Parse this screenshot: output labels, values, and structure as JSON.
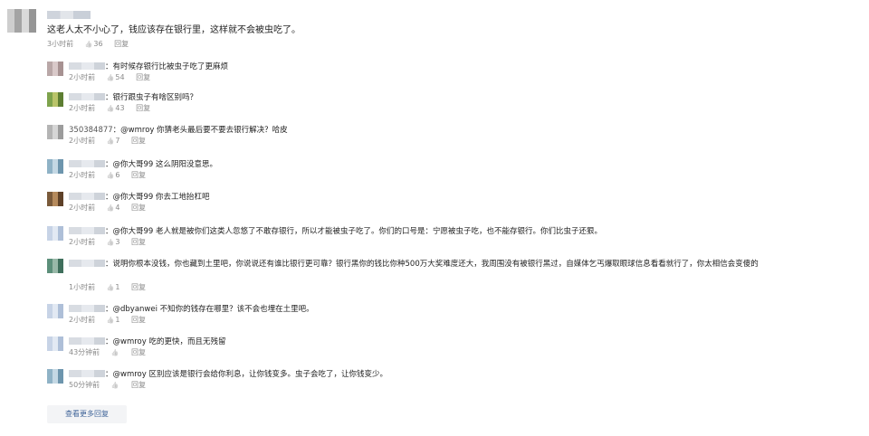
{
  "top_comment": {
    "text": "这老人太不小心了，钱应该存在银行里，这样就不会被虫吃了。",
    "time": "3小时前",
    "likes": "36",
    "reply_label": "回复"
  },
  "replies": [
    {
      "username": "",
      "text": "：有时候存银行比被虫子吃了更麻烦",
      "time": "2小时前",
      "likes": "54",
      "reply_label": "回复"
    },
    {
      "username": "",
      "text": "：银行跟虫子有啥区别吗？",
      "time": "2小时前",
      "likes": "43",
      "reply_label": "回复"
    },
    {
      "username": "350384877",
      "text": "：@wmroy 你猜老头最后要不要去银行解决？哈皮",
      "time": "2小时前",
      "likes": "7",
      "reply_label": "回复"
    },
    {
      "username": "",
      "text": "：@你大哥99 这么阴阳没意思。",
      "time": "2小时前",
      "likes": "6",
      "reply_label": "回复"
    },
    {
      "username": "",
      "text": "：@你大哥99 你去工地抬杠吧",
      "time": "2小时前",
      "likes": "4",
      "reply_label": "回复"
    },
    {
      "username": "",
      "text": "：@你大哥99 老人就是被你们这类人忽悠了不敢存银行，所以才能被虫子吃了。你们的口号是：宁愿被虫子吃，也不能存银行。你们比虫子还狠。",
      "time": "2小时前",
      "likes": "3",
      "reply_label": "回复"
    },
    {
      "username": "",
      "text": "：说明你根本没钱，你也藏到土里吧，你说说还有谁比银行更可靠？银行黑你的钱比你种500万大奖难度还大，我周围没有被银行黑过，自媒体乞丐爆取眼球信息看看就行了，你太相信会变傻的",
      "time": "1小时前",
      "likes": "1",
      "reply_label": "回复"
    },
    {
      "username": "",
      "text": "：@dbyanwei 不知你的钱存在哪里？该不会也埋在土里吧。",
      "time": "2小时前",
      "likes": "1",
      "reply_label": "回复"
    },
    {
      "username": "",
      "text": "：@wmroy 吃的更快，而且无残留",
      "time": "43分钟前",
      "likes": "",
      "reply_label": "回复"
    },
    {
      "username": "",
      "text": "：@wmroy 区别应该是银行会给你利息，让你钱变多。虫子会吃了，让你钱变少。",
      "time": "50分钟前",
      "likes": "",
      "reply_label": "回复"
    }
  ],
  "load_more_label": "查看更多回复",
  "colors": {
    "link": "#406599",
    "meta": "#8a8a8a",
    "button_bg": "#f3f4f6"
  }
}
